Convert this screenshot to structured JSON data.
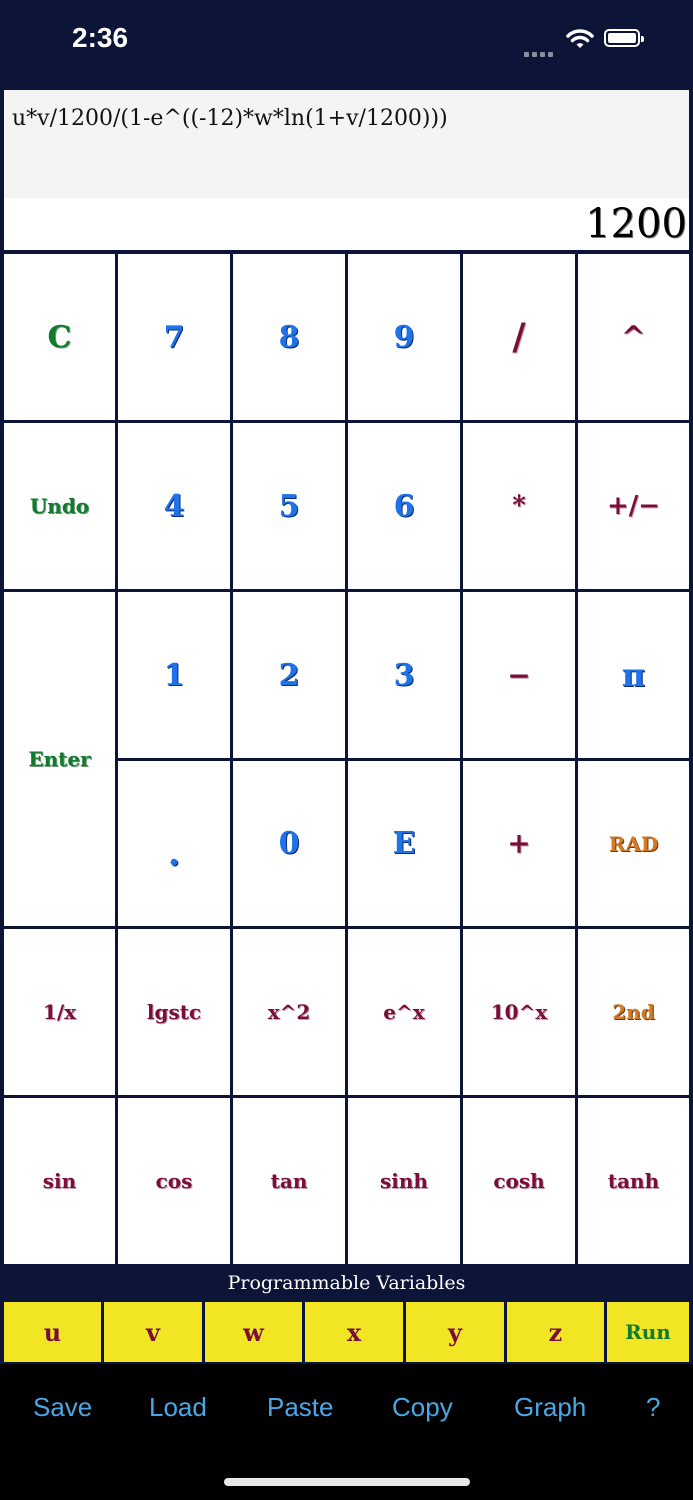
{
  "status": {
    "time": "2:36"
  },
  "display": {
    "expression": "u*v/1200/(1-e^((-12)*w*ln(1+v/1200)))",
    "result": "1200"
  },
  "keys": {
    "clear": "C",
    "seven": "7",
    "eight": "8",
    "nine": "9",
    "divide": "/",
    "power": "^",
    "undo": "Undo",
    "four": "4",
    "five": "5",
    "six": "6",
    "multiply": "*",
    "negate": "+/−",
    "enter": "Enter",
    "one": "1",
    "two": "2",
    "three": "3",
    "minus": "−",
    "pi": "π",
    "dot": ".",
    "zero": "0",
    "exp": "E",
    "plus": "+",
    "rad": "RAD",
    "reciprocal": "1/x",
    "lgstc": "lgstc",
    "square": "x^2",
    "e_pow": "e^x",
    "ten_pow": "10^x",
    "second": "2nd",
    "sin": "sin",
    "cos": "cos",
    "tan": "tan",
    "sinh": "sinh",
    "cosh": "cosh",
    "tanh": "tanh"
  },
  "variables": {
    "title": "Programmable Variables",
    "items": [
      "u",
      "v",
      "w",
      "x",
      "y",
      "z"
    ],
    "run": "Run"
  },
  "toolbar": {
    "save": "Save",
    "load": "Load",
    "paste": "Paste",
    "copy": "Copy",
    "graph": "Graph",
    "help": "?"
  },
  "colors": {
    "background": "#0c1538",
    "green": "#127a2e",
    "blue": "#1e73e8",
    "maroon": "#7a0e3a",
    "orange": "#d27a25",
    "variable_bar": "#f2e624",
    "toolbar_link": "#4aa7e6"
  }
}
